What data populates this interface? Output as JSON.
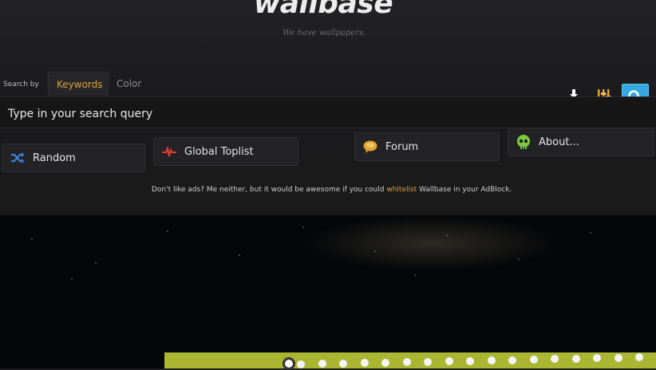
{
  "header": {
    "logo_text": "wallbase",
    "tagline": "We have wallpapers."
  },
  "search": {
    "search_by_label": "Search by",
    "tabs": [
      {
        "label": "Keywords",
        "active": true
      },
      {
        "label": "Color",
        "active": false
      }
    ],
    "placeholder": "Type in your search query"
  },
  "toolbar": {
    "icons": [
      "download-icon",
      "filters-icon",
      "search-icon"
    ],
    "accent": "#35a8e0"
  },
  "nav": {
    "items": [
      {
        "label": "Random",
        "icon": "shuffle-icon",
        "icon_color": "#3a7fd6"
      },
      {
        "label": "Global Toplist",
        "icon": "pulse-icon",
        "icon_color": "#e0403a"
      },
      {
        "label": "Forum",
        "icon": "speech-bubble-icon",
        "icon_color": "#e3a235"
      },
      {
        "label": "About...",
        "icon": "skull-icon",
        "icon_color": "#7ccc3a"
      }
    ]
  },
  "ad_note": {
    "before": "Don't like ads? Me neither, but it would be awesome if you could ",
    "link": "whitelist",
    "after": " Wallbase in your AdBlock."
  },
  "colors": {
    "link": "#e0a43c",
    "background": "#1d1d1f",
    "scroller": "#aab531"
  }
}
